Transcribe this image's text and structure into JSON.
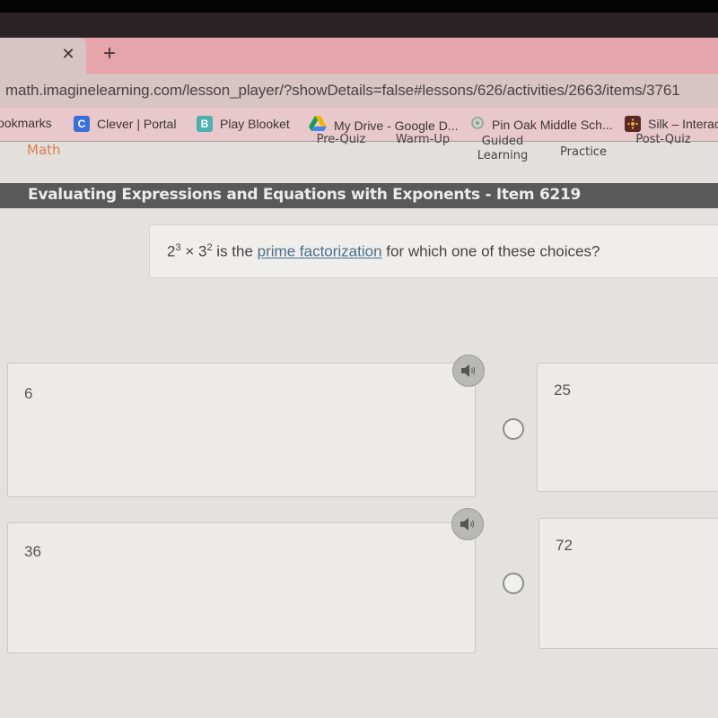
{
  "browser": {
    "tab_close_icon": "close-icon",
    "new_tab_icon": "plus-icon",
    "url": "math.imaginelearning.com/lesson_player/?showDetails=false#lessons/626/activities/2663/items/3761",
    "bookmarks": [
      {
        "label": "ookmarks",
        "icon": ""
      },
      {
        "label": "Clever | Portal",
        "icon": "C",
        "color": "#3a6fd8"
      },
      {
        "label": "Play Blooket",
        "icon": "B",
        "color": "#4fb0b0"
      },
      {
        "label": "My Drive - Google D...",
        "icon": "google-drive-icon"
      },
      {
        "label": "Pin Oak Middle Sch...",
        "icon": "school-icon"
      },
      {
        "label": "Silk – Interac",
        "icon": "silk-icon",
        "color": "#5a2a20"
      }
    ]
  },
  "lesson_nav": {
    "subject": "Math",
    "tabs": [
      {
        "label": "Pre-Quiz"
      },
      {
        "label": "Warm-Up"
      },
      {
        "label": "Guided Learning",
        "line1": "Guided",
        "line2": "Learning"
      },
      {
        "label": "Practice"
      },
      {
        "label": "Post-Quiz"
      }
    ]
  },
  "item": {
    "title": "Evaluating Expressions and Equations with Exponents - Item 6219",
    "prompt": {
      "base1": "2",
      "exp1": "3",
      "times": " × ",
      "base2": "3",
      "exp2": "2",
      "text_before_link": " is the ",
      "link": "prime factorization",
      "text_after_link": " for which one of these choices?"
    },
    "choices": [
      {
        "label": "6",
        "selected": false
      },
      {
        "label": "25",
        "selected": false
      },
      {
        "label": "36",
        "selected": false
      },
      {
        "label": "72",
        "selected": false
      }
    ]
  }
}
